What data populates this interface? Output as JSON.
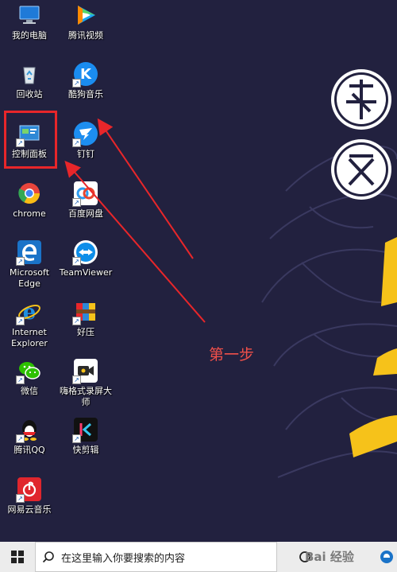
{
  "desktop_icons": [
    {
      "id": "computer",
      "label": "我的电脑",
      "icon": "computer-icon"
    },
    {
      "id": "tencent-video",
      "label": "腾讯视频",
      "icon": "tencent-video-icon"
    },
    {
      "id": "recycle-bin",
      "label": "回收站",
      "icon": "recycle-bin-icon"
    },
    {
      "id": "kugou-music",
      "label": "酷狗音乐",
      "icon": "kugou-icon"
    },
    {
      "id": "control-panel",
      "label": "控制面板",
      "icon": "control-panel-icon"
    },
    {
      "id": "dingtalk",
      "label": "钉钉",
      "icon": "dingtalk-icon"
    },
    {
      "id": "chrome",
      "label": "chrome",
      "icon": "chrome-icon"
    },
    {
      "id": "baidu-netdisk",
      "label": "百度网盘",
      "icon": "baidu-netdisk-icon"
    },
    {
      "id": "edge",
      "label": "Microsoft\nEdge",
      "icon": "edge-icon"
    },
    {
      "id": "teamviewer",
      "label": "TeamViewer",
      "icon": "teamviewer-icon"
    },
    {
      "id": "ie",
      "label": "Internet\nExplorer",
      "icon": "internet-explorer-icon"
    },
    {
      "id": "haozip",
      "label": "好压",
      "icon": "haozip-icon"
    },
    {
      "id": "wechat",
      "label": "微信",
      "icon": "wechat-icon"
    },
    {
      "id": "screen-recorder",
      "label": "嗨格式录屏大\n师",
      "icon": "screen-recorder-icon"
    },
    {
      "id": "qq",
      "label": "腾讯QQ",
      "icon": "qq-icon"
    },
    {
      "id": "kuaijianji",
      "label": "快剪辑",
      "icon": "kuaijianji-icon"
    },
    {
      "id": "netease-music",
      "label": "网易云音乐",
      "icon": "netease-music-icon"
    }
  ],
  "annotation": {
    "text": "第一步",
    "color": "#f0504a"
  },
  "taskbar": {
    "search_placeholder": "在这里输入你要搜索的内容",
    "watermark": "Bai 经验"
  },
  "colors": {
    "wallpaper": "#22213f",
    "highlight": "#e8262a",
    "accent_yellow": "#f6c21a"
  }
}
